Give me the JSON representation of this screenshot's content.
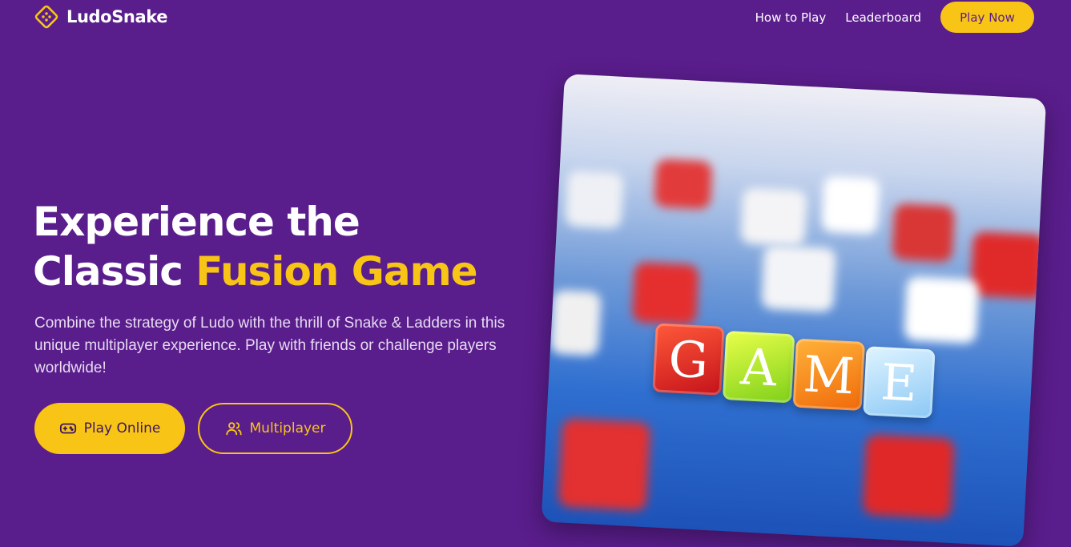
{
  "header": {
    "logo_text": "LudoSnake",
    "nav": [
      "How to Play",
      "Leaderboard"
    ],
    "cta_label": "Play Now"
  },
  "hero": {
    "title_line1": "Experience the",
    "title_line2_plain": "Classic ",
    "title_line2_accent": "Fusion Game",
    "description": "Combine the strategy of Ludo with the thrill of Snake & Ladders in this unique multiplayer experience. Play with friends or challenge players worldwide!",
    "primary_button": "Play Online",
    "secondary_button": "Multiplayer",
    "image_letters": [
      "G",
      "A",
      "M",
      "E"
    ]
  },
  "colors": {
    "background": "#5a1d8c",
    "accent": "#f8c516"
  }
}
